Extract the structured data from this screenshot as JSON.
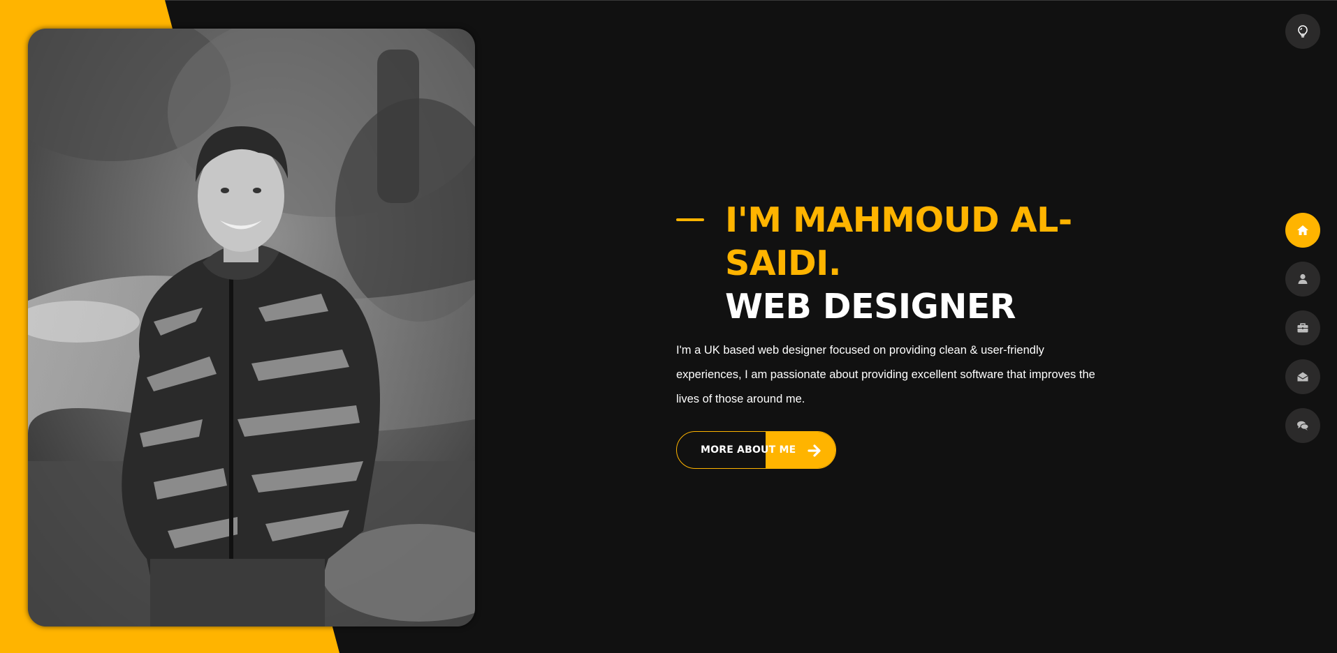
{
  "hero": {
    "heading_name": "I'M MAHMOUD AL-SAIDI.",
    "heading_role": "WEB DESIGNER",
    "intro": "I'm a UK based web designer focused on providing clean & user-friendly experiences, I am passionate about providing excellent software that improves the lives of those around me.",
    "cta_label": "MORE ABOUT ME",
    "cta_icon": "arrow-right-icon"
  },
  "photo": {
    "description_alt": "Portrait photo"
  },
  "nav": {
    "theme_toggle_icon": "lightbulb-icon",
    "items": [
      {
        "icon": "home-icon",
        "active": true
      },
      {
        "icon": "user-icon",
        "active": false
      },
      {
        "icon": "briefcase-icon",
        "active": false
      },
      {
        "icon": "envelope-open-icon",
        "active": false
      },
      {
        "icon": "comments-icon",
        "active": false
      }
    ]
  },
  "colors": {
    "accent": "#ffb400",
    "background": "#111111",
    "nav_button": "#2b2a2a"
  }
}
